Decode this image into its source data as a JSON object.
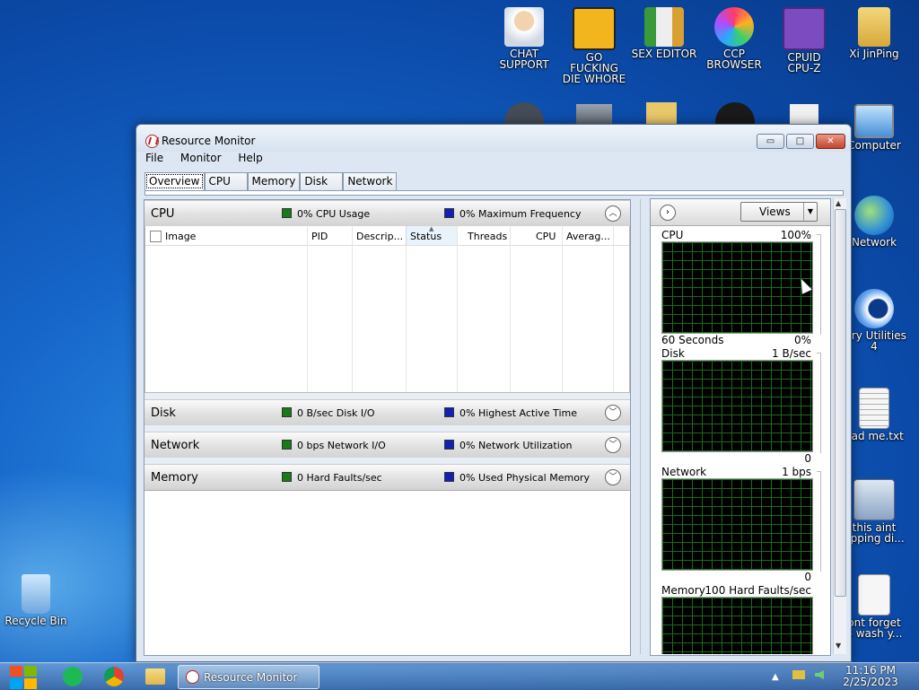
{
  "desktop": {
    "icons": [
      {
        "label": "CHAT\nSUPPORT",
        "icon": "support-person-icon",
        "color": "#e9c49a"
      },
      {
        "label": "GO FUCKING\nDIE WHORE",
        "icon": "die-logo-icon",
        "color": "#f2b51e"
      },
      {
        "label": "SEX EDITOR",
        "icon": "hxd-editor-icon",
        "color": "#dcdcdc"
      },
      {
        "label": "CCP\nBROWSER",
        "icon": "browser-logo-icon",
        "color": "#ff8a3a"
      },
      {
        "label": "CPUID\nCPU-Z",
        "icon": "cpuz-icon",
        "color": "#7c4bbf"
      },
      {
        "label": "Xi JinPing",
        "icon": "user-folder-icon",
        "color": "#e8c86a"
      },
      {
        "label": "Computer",
        "icon": "computer-icon",
        "color": "#8fc4ef"
      },
      {
        "label": "Network",
        "icon": "network-globe-icon",
        "color": "#3c8ad8"
      },
      {
        "label": "lary Utilities\n4",
        "icon": "glary-utilities-icon",
        "color": "#2a6fd0"
      },
      {
        "label": "ead me.txt",
        "icon": "text-file-icon",
        "color": "#f4f4f4"
      },
      {
        "label": "this aint\nopping di...",
        "icon": "disk-search-icon",
        "color": "#b8c8dc"
      },
      {
        "label": "ont forget\no wash y...",
        "icon": "calendar-file-icon",
        "color": "#f4f4f4"
      },
      {
        "label": "Recycle Bin",
        "icon": "recycle-bin-icon",
        "color": "#c6e2f4"
      }
    ]
  },
  "window": {
    "title": "Resource Monitor",
    "menu": [
      "File",
      "Monitor",
      "Help"
    ],
    "tabs": [
      "Overview",
      "CPU",
      "Memory",
      "Disk",
      "Network"
    ],
    "active_tab": "Overview",
    "controls": {
      "minimize": "▭",
      "maximize": "□",
      "close": "✕"
    }
  },
  "sections": {
    "cpu": {
      "name": "CPU",
      "metric1": "0% CPU Usage",
      "metric2": "0% Maximum Frequency",
      "expanded": true
    },
    "disk": {
      "name": "Disk",
      "metric1": "0 B/sec Disk I/O",
      "metric2": "0% Highest Active Time"
    },
    "network": {
      "name": "Network",
      "metric1": "0 bps Network I/O",
      "metric2": "0% Network Utilization"
    },
    "memory": {
      "name": "Memory",
      "metric1": "0 Hard Faults/sec",
      "metric2": "0% Used Physical Memory"
    }
  },
  "cpu_table": {
    "columns": [
      "Image",
      "PID",
      "Descrip...",
      "Status",
      "Threads",
      "CPU",
      "Averag..."
    ],
    "sorted_column": "Status"
  },
  "right_panel": {
    "views_label": "Views",
    "graphs": [
      {
        "name": "CPU",
        "top_right": "100%",
        "bottom_left": "60 Seconds",
        "bottom_right": "0%"
      },
      {
        "name": "Disk",
        "top_right": "1 B/sec",
        "bottom_left": "",
        "bottom_right": "0"
      },
      {
        "name": "Network",
        "top_right": "1 bps",
        "bottom_left": "",
        "bottom_right": "0"
      },
      {
        "name": "Memory",
        "top_right": "100 Hard Faults/sec",
        "bottom_left": "",
        "bottom_right": ""
      }
    ]
  },
  "taskbar": {
    "task_label": "Resource Monitor",
    "time": "11:16 PM",
    "date": "2/25/2023"
  },
  "colors": {
    "metric_green": "#1a7a1a",
    "metric_blue": "#1020b8",
    "graph_grid": "#1a6b1a"
  }
}
